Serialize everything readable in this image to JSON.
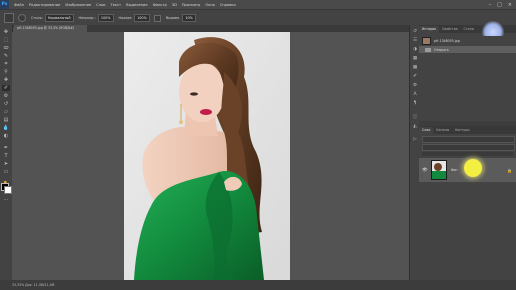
{
  "app": {
    "logo": "Ps"
  },
  "menu": [
    "Файл",
    "Редактирование",
    "Изображение",
    "Слои",
    "Текст",
    "Выделение",
    "Фильтр",
    "3D",
    "Просмотр",
    "Окно",
    "Справка"
  ],
  "window_controls": [
    "–",
    "□",
    "×"
  ],
  "options": {
    "style_label": "Стиль:",
    "style_value": "Нормальный",
    "opacity_label": "Непрозр.:",
    "opacity_value": "100%",
    "pressure_label": "Нажим:",
    "pressure_value": "100%",
    "align_label": "Выравн.",
    "sample_value": "10%"
  },
  "document": {
    "tab_title": "рН-1348055.jpg @ 33,3% (RGB/8#)"
  },
  "status": {
    "text": "33,33%   Док: 11,4M/11,4M"
  },
  "panels": {
    "history_tabs": [
      "История",
      "Свойства",
      "Стили"
    ],
    "history_snapshot": "рН-1348055.jpg",
    "history_item": "Открыть",
    "layers_tabs": [
      "Слои",
      "Каналы",
      "Контуры"
    ],
    "layer_name": "Фон"
  },
  "colors": {
    "accent": "#31a8ff",
    "panel": "#434343",
    "workspace": "#535353",
    "dress": "#1a9a4a",
    "cursor": "#f4ef43"
  },
  "tools": [
    "move-icon",
    "marquee-icon",
    "lasso-icon",
    "quick-select-icon",
    "crop-icon",
    "eyedropper-icon",
    "healing-icon",
    "brush-icon",
    "stamp-icon",
    "history-brush-icon",
    "eraser-icon",
    "gradient-icon",
    "blur-icon",
    "dodge-icon",
    "pen-icon",
    "type-icon",
    "path-select-icon",
    "shape-icon",
    "hand-icon",
    "zoom-icon"
  ]
}
